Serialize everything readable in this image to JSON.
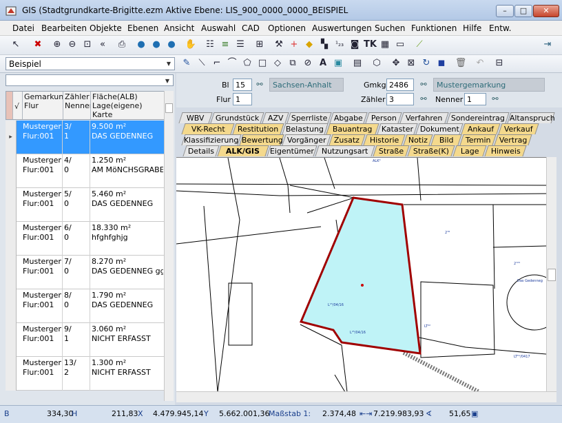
{
  "window": {
    "title": "GIS (Stadtgrundkarte-Brigitte.ezm Aktive Ebene: LIS_900_0000_0000_BEISPIEL",
    "minimize": "–",
    "maximize": "□",
    "close": "✕"
  },
  "menu": [
    "Datei",
    "Bearbeiten",
    "Objekte",
    "Ebenen",
    "Ansicht",
    "Auswahl",
    "CAD",
    "Optionen",
    "Auswertungen",
    "Suchen",
    "Funktionen",
    "Hilfe",
    "Entw."
  ],
  "toolbar": {
    "layer_combo": "Beispiel"
  },
  "left": {
    "filter_combo": "",
    "headers": {
      "check": "√",
      "col1": "Gemarkung\nFlur",
      "col2": "Zähler\nNenner",
      "col3": "Fläche(ALB)\nLage(eigene)\nKarte"
    },
    "rows": [
      {
        "gem": "Mustergema",
        "flur": "Flur:001",
        "zaehler": "3/",
        "nenner": "1",
        "flaeche": "9.500 m²",
        "lage": "DAS GEDENNEG"
      },
      {
        "gem": "Mustergema",
        "flur": "Flur:001",
        "zaehler": "4/",
        "nenner": "0",
        "flaeche": "1.250 m²",
        "lage": "AM MöNCHSGRABE"
      },
      {
        "gem": "Mustergema",
        "flur": "Flur:001",
        "zaehler": "5/",
        "nenner": "0",
        "flaeche": "5.460 m²",
        "lage": "DAS GEDENNEG"
      },
      {
        "gem": "Mustergema",
        "flur": "Flur:001",
        "zaehler": "6/",
        "nenner": "0",
        "flaeche": "18.330 m²",
        "lage": "hfghfghjg"
      },
      {
        "gem": "Mustergema",
        "flur": "Flur:001",
        "zaehler": "7/",
        "nenner": "0",
        "flaeche": "8.270 m²",
        "lage": "DAS GEDENNEG ggl"
      },
      {
        "gem": "Mustergema",
        "flur": "Flur:001",
        "zaehler": "8/",
        "nenner": "0",
        "flaeche": "1.790 m²",
        "lage": "DAS GEDENNEG"
      },
      {
        "gem": "Mustergema",
        "flur": "Flur:001",
        "zaehler": "9/",
        "nenner": "1",
        "flaeche": "3.060 m²",
        "lage": "NICHT ERFASST"
      },
      {
        "gem": "Mustergema",
        "flur": "Flur:001",
        "zaehler": "13/",
        "nenner": "2",
        "flaeche": "1.300 m²",
        "lage": "NICHT ERFASST"
      }
    ]
  },
  "info": {
    "bl_label": "Bl",
    "bl_value": "15",
    "bl_name": "Sachsen-Anhalt",
    "flur_label": "Flur",
    "flur_value": "1",
    "gmkg_label": "Gmkg",
    "gmkg_value": "2486",
    "gmkg_name": "Mustergemarkung",
    "zaehler_label": "Zähler",
    "zaehler_value": "3",
    "nenner_label": "Nenner",
    "nenner_value": "1"
  },
  "tabs": {
    "row1": [
      "WBV",
      "Grundstück",
      "AZV",
      "Sperrliste",
      "Abgabe",
      "Person",
      "Verfahren",
      "Sondereintrag",
      "Altanspruch"
    ],
    "row2": [
      "VK-Recht",
      "Restitution",
      "Belastung",
      "Bauantrag",
      "Kataster",
      "Dokument",
      "Ankauf",
      "Verkauf"
    ],
    "row3": [
      "Klassifizierung",
      "Bewertung",
      "Vorgänger",
      "Zusatz",
      "Historie",
      "Notiz",
      "Bild",
      "Termin",
      "Vertrag"
    ],
    "row4": [
      "Details",
      "ALK/GIS",
      "Eigentümer",
      "Nutzungsart",
      "Straße",
      "Straße(K)",
      "Lage",
      "Hinweis"
    ],
    "active": "ALK/GIS"
  },
  "map": {
    "labels": [
      "Das Gedenneg",
      "L¹⁵/04/16",
      "L²⁵/04/16",
      "LT²²",
      "LT⁰¹/0417",
      "2⁷²⁵",
      "2⁷⁸",
      "ALK⁰"
    ]
  },
  "status": {
    "mode": "B",
    "v1": "334,30",
    "v1_unit": "H",
    "v2": "211,83",
    "v2_unit": "X",
    "v3": "4.479.945,14",
    "v3_unit": "Y",
    "v4": "5.662.001,36",
    "scale_label": "Maßstab 1:",
    "scale_value": "2.374,48",
    "v6": "7.219.983,93",
    "v7": "51,65"
  },
  "colors": {
    "selection": "#3399ff",
    "parcel_fill": "#bff3f7",
    "parcel_stroke": "#a00000",
    "tab_gold": "#f4d98d"
  }
}
